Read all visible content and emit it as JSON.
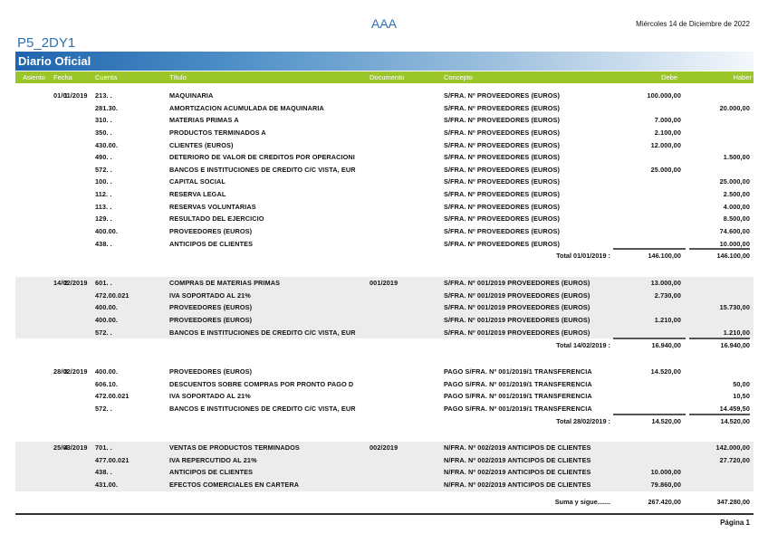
{
  "header": {
    "company": "AAA",
    "date": "Miércoles 14 de Diciembre de 2022",
    "code": "P5_2DY1",
    "report_title": "Diario Oficial"
  },
  "columns": {
    "asiento": "Asiento",
    "fecha": "Fecha",
    "cuenta": "Cuenta",
    "titulo": "Título",
    "documento": "Documento",
    "concepto": "Concepto",
    "debe": "Debe",
    "haber": "Haber"
  },
  "colors": {
    "brand_blue": "#1f64ae",
    "header_green": "#9bc62a",
    "row_shade": "#ececec"
  },
  "entries": [
    {
      "asiento": "1",
      "fecha": "01/01/2019",
      "rows": [
        {
          "cuenta": "213. .",
          "titulo": "MAQUINARIA",
          "documento": "",
          "concepto": "S/FRA. Nº PROVEEDORES (EUROS)",
          "debe": "100.000,00",
          "haber": ""
        },
        {
          "cuenta": "281.30.",
          "titulo": "AMORTIZACION ACUMULADA DE MAQUINARIA",
          "documento": "",
          "concepto": "S/FRA. Nº PROVEEDORES (EUROS)",
          "debe": "",
          "haber": "20.000,00"
        },
        {
          "cuenta": "310. .",
          "titulo": "MATERIAS PRIMAS A",
          "documento": "",
          "concepto": "S/FRA. Nº PROVEEDORES (EUROS)",
          "debe": "7.000,00",
          "haber": ""
        },
        {
          "cuenta": "350. .",
          "titulo": "PRODUCTOS TERMINADOS A",
          "documento": "",
          "concepto": "S/FRA. Nº PROVEEDORES (EUROS)",
          "debe": "2.100,00",
          "haber": ""
        },
        {
          "cuenta": "430.00.",
          "titulo": "CLIENTES (EUROS)",
          "documento": "",
          "concepto": "S/FRA. Nº PROVEEDORES (EUROS)",
          "debe": "12.000,00",
          "haber": ""
        },
        {
          "cuenta": "490. .",
          "titulo": "DETERIORO DE VALOR DE CREDITOS POR OPERACIONI",
          "documento": "",
          "concepto": "S/FRA. Nº PROVEEDORES (EUROS)",
          "debe": "",
          "haber": "1.500,00"
        },
        {
          "cuenta": "572. .",
          "titulo": "BANCOS E INSTITUCIONES DE CREDITO C/C VISTA, EUR",
          "documento": "",
          "concepto": "S/FRA. Nº PROVEEDORES (EUROS)",
          "debe": "25.000,00",
          "haber": ""
        },
        {
          "cuenta": "100. .",
          "titulo": "CAPITAL SOCIAL",
          "documento": "",
          "concepto": "S/FRA. Nº PROVEEDORES (EUROS)",
          "debe": "",
          "haber": "25.000,00"
        },
        {
          "cuenta": "112. .",
          "titulo": "RESERVA LEGAL",
          "documento": "",
          "concepto": "S/FRA. Nº PROVEEDORES (EUROS)",
          "debe": "",
          "haber": "2.500,00"
        },
        {
          "cuenta": "113. .",
          "titulo": "RESERVAS VOLUNTARIAS",
          "documento": "",
          "concepto": "S/FRA. Nº PROVEEDORES (EUROS)",
          "debe": "",
          "haber": "4.000,00"
        },
        {
          "cuenta": "129. .",
          "titulo": "RESULTADO DEL EJERCICIO",
          "documento": "",
          "concepto": "S/FRA. Nº PROVEEDORES (EUROS)",
          "debe": "",
          "haber": "8.500,00"
        },
        {
          "cuenta": "400.00.",
          "titulo": "PROVEEDORES (EUROS)",
          "documento": "",
          "concepto": "S/FRA. Nº PROVEEDORES (EUROS)",
          "debe": "",
          "haber": "74.600,00"
        },
        {
          "cuenta": "438. .",
          "titulo": "ANTICIPOS DE CLIENTES",
          "documento": "",
          "concepto": "S/FRA. Nº PROVEEDORES (EUROS)",
          "debe": "",
          "haber": "10.000,00"
        }
      ],
      "total": {
        "label": "Total 01/01/2019 :",
        "debe": "146.100,00",
        "haber": "146.100,00"
      }
    },
    {
      "asiento": "2",
      "fecha": "14/02/2019",
      "rows": [
        {
          "cuenta": "601. .",
          "titulo": "COMPRAS DE MATERIAS PRIMAS",
          "documento": "001/2019",
          "concepto": "S/FRA. Nº 001/2019 PROVEEDORES (EUROS)",
          "debe": "13.000,00",
          "haber": ""
        },
        {
          "cuenta": "472.00.021",
          "titulo": "IVA SOPORTADO AL 21%",
          "documento": "",
          "concepto": "S/FRA. Nº 001/2019 PROVEEDORES (EUROS)",
          "debe": "2.730,00",
          "haber": ""
        },
        {
          "cuenta": "400.00.",
          "titulo": "PROVEEDORES (EUROS)",
          "documento": "",
          "concepto": "S/FRA. Nº 001/2019 PROVEEDORES (EUROS)",
          "debe": "",
          "haber": "15.730,00"
        },
        {
          "cuenta": "400.00.",
          "titulo": "PROVEEDORES (EUROS)",
          "documento": "",
          "concepto": "S/FRA. Nº 001/2019 PROVEEDORES (EUROS)",
          "debe": "1.210,00",
          "haber": ""
        },
        {
          "cuenta": "572. .",
          "titulo": "BANCOS E INSTITUCIONES DE CREDITO C/C VISTA, EUR",
          "documento": "",
          "concepto": "S/FRA. Nº 001/2019 PROVEEDORES (EUROS)",
          "debe": "",
          "haber": "1.210,00"
        }
      ],
      "total": {
        "label": "Total 14/02/2019 :",
        "debe": "16.940,00",
        "haber": "16.940,00"
      }
    },
    {
      "asiento": "3",
      "fecha": "28/02/2019",
      "rows": [
        {
          "cuenta": "400.00.",
          "titulo": "PROVEEDORES (EUROS)",
          "documento": "",
          "concepto": "PAGO S/FRA. Nº 001/2019/1 TRANSFERENCIA",
          "debe": "14.520,00",
          "haber": ""
        },
        {
          "cuenta": "606.10.",
          "titulo": "DESCUENTOS SOBRE COMPRAS POR PRONTO PAGO D",
          "documento": "",
          "concepto": "PAGO S/FRA. Nº 001/2019/1 TRANSFERENCIA",
          "debe": "",
          "haber": "50,00"
        },
        {
          "cuenta": "472.00.021",
          "titulo": "IVA SOPORTADO AL 21%",
          "documento": "",
          "concepto": "PAGO S/FRA. Nº 001/2019/1 TRANSFERENCIA",
          "debe": "",
          "haber": "10,50"
        },
        {
          "cuenta": "572. .",
          "titulo": "BANCOS E INSTITUCIONES DE CREDITO C/C VISTA, EUR",
          "documento": "",
          "concepto": "PAGO S/FRA. Nº 001/2019/1 TRANSFERENCIA",
          "debe": "",
          "haber": "14.459,50"
        }
      ],
      "total": {
        "label": "Total 28/02/2019 :",
        "debe": "14.520,00",
        "haber": "14.520,00"
      }
    },
    {
      "asiento": "4",
      "fecha": "25/03/2019",
      "rows": [
        {
          "cuenta": "701. .",
          "titulo": "VENTAS DE PRODUCTOS TERMINADOS",
          "documento": "002/2019",
          "concepto": "N/FRA. Nº 002/2019 ANTICIPOS DE CLIENTES",
          "debe": "",
          "haber": "142.000,00"
        },
        {
          "cuenta": "477.00.021",
          "titulo": "IVA REPERCUTIDO AL 21%",
          "documento": "",
          "concepto": "N/FRA. Nº 002/2019 ANTICIPOS DE CLIENTES",
          "debe": "",
          "haber": "27.720,00"
        },
        {
          "cuenta": "438. .",
          "titulo": "ANTICIPOS DE CLIENTES",
          "documento": "",
          "concepto": "N/FRA. Nº 002/2019 ANTICIPOS DE CLIENTES",
          "debe": "10.000,00",
          "haber": ""
        },
        {
          "cuenta": "431.00.",
          "titulo": "EFECTOS COMERCIALES EN CARTERA",
          "documento": "",
          "concepto": "N/FRA. Nº 002/2019 ANTICIPOS DE CLIENTES",
          "debe": "79.860,00",
          "haber": ""
        }
      ]
    }
  ],
  "carry": {
    "label": "Suma y sigue.......",
    "debe": "267.420,00",
    "haber": "347.280,00"
  },
  "footer": {
    "page": "Página 1"
  }
}
